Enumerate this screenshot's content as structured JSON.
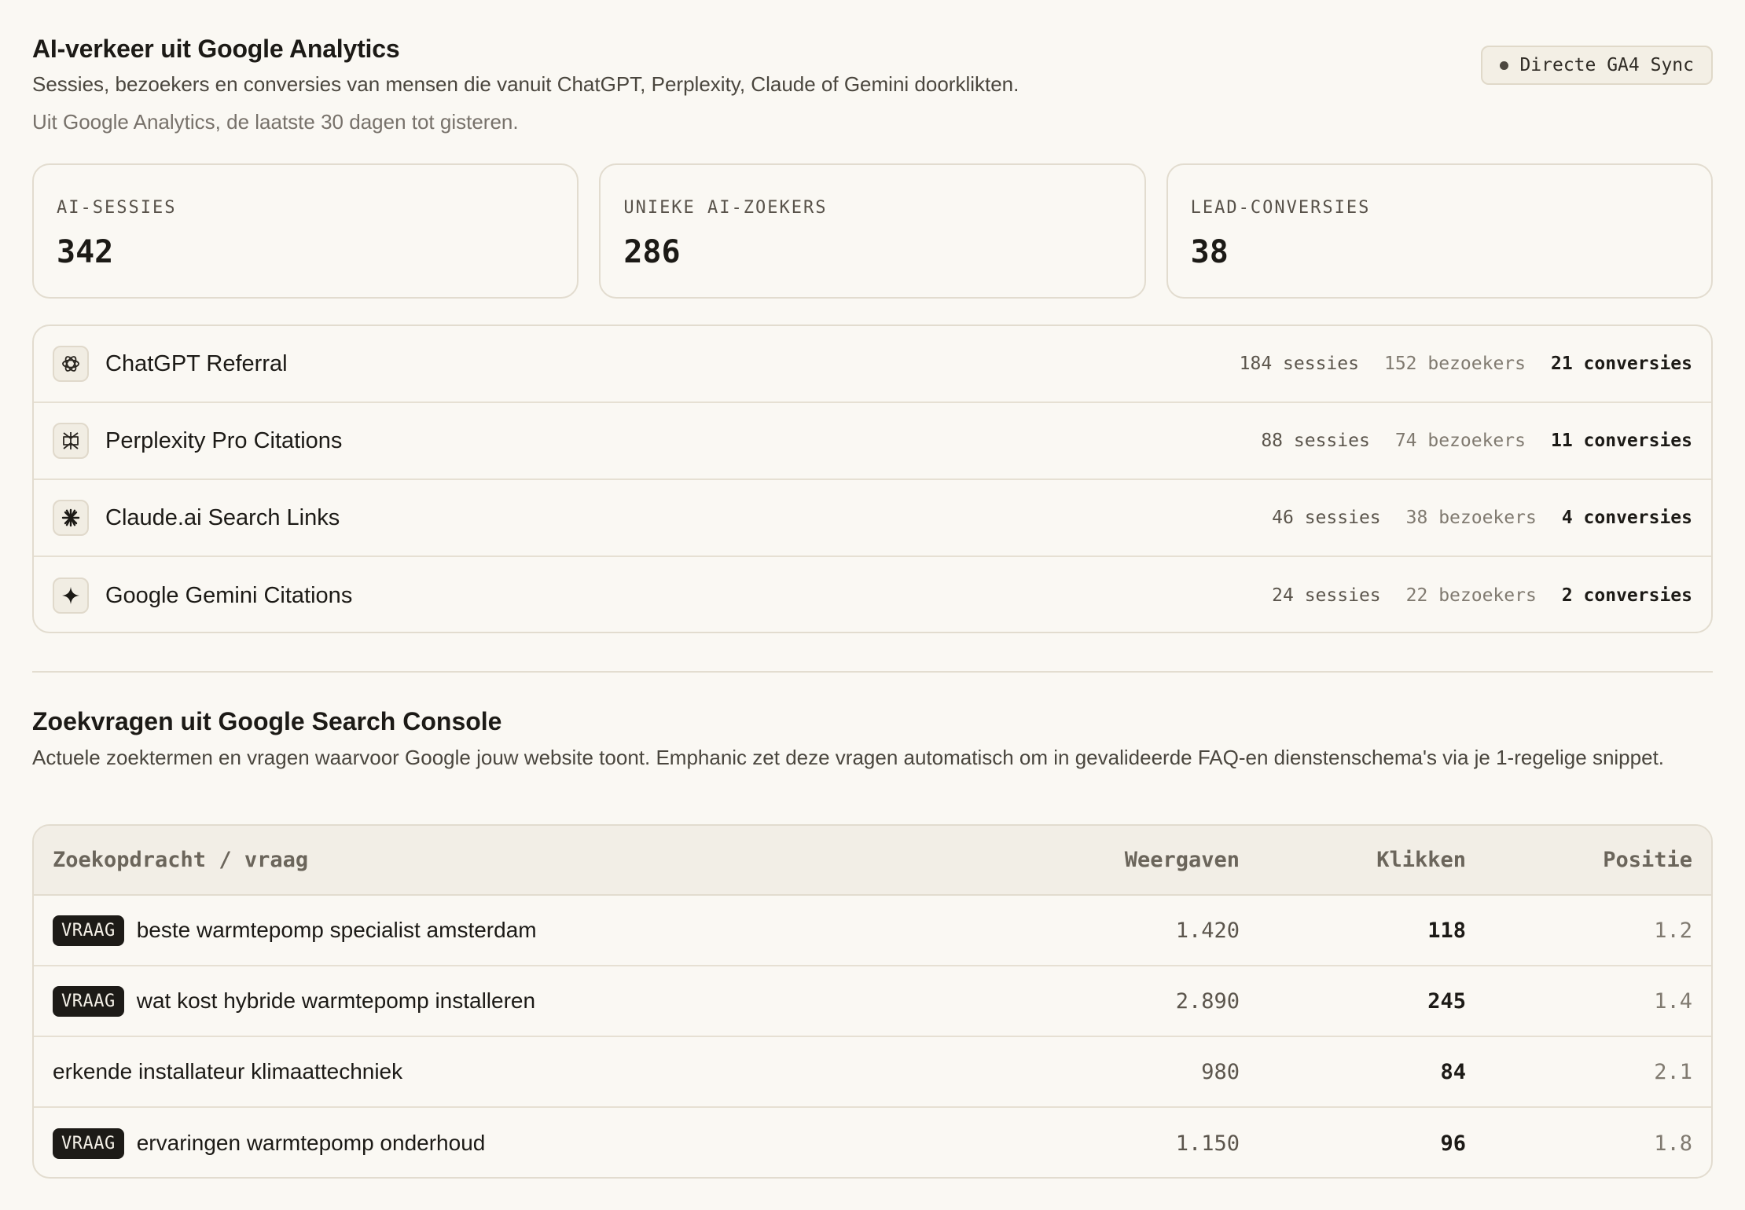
{
  "ga": {
    "title": "AI-verkeer uit Google Analytics",
    "subtitle": "Sessies, bezoekers en conversies van mensen die vanuit ChatGPT, Perplexity, Claude of Gemini doorklikten.",
    "note": "Uit Google Analytics, de laatste 30 dagen tot gisteren.",
    "sync_label": "Directe GA4 Sync",
    "metrics": [
      {
        "label": "AI-SESSIES",
        "value": "342"
      },
      {
        "label": "UNIEKE AI-ZOEKERS",
        "value": "286"
      },
      {
        "label": "LEAD-CONVERSIES",
        "value": "38"
      }
    ],
    "sources": [
      {
        "name": "ChatGPT Referral",
        "icon": "chatgpt-icon",
        "sessions": "184 sessies",
        "visitors": "152 bezoekers",
        "conversions": "21 conversies"
      },
      {
        "name": "Perplexity Pro Citations",
        "icon": "perplexity-icon",
        "sessions": "88 sessies",
        "visitors": "74 bezoekers",
        "conversions": "11 conversies"
      },
      {
        "name": "Claude.ai Search Links",
        "icon": "claude-icon",
        "sessions": "46 sessies",
        "visitors": "38 bezoekers",
        "conversions": "4 conversies"
      },
      {
        "name": "Google Gemini Citations",
        "icon": "gemini-icon",
        "sessions": "24 sessies",
        "visitors": "22 bezoekers",
        "conversions": "2 conversies"
      }
    ]
  },
  "gsc": {
    "title": "Zoekvragen uit Google Search Console",
    "subtitle": "Actuele zoektermen en vragen waarvoor Google jouw website toont. Emphanic zet deze vragen automatisch om in gevalideerde FAQ-en dienstenschema's via je 1-regelige snippet.",
    "columns": {
      "query": "Zoekopdracht / vraag",
      "impressions": "Weergaven",
      "clicks": "Klikken",
      "position": "Positie"
    },
    "badge_label": "VRAAG",
    "rows": [
      {
        "is_question": true,
        "query": "beste warmtepomp specialist amsterdam",
        "impressions": "1.420",
        "clicks": "118",
        "position": "1.2"
      },
      {
        "is_question": true,
        "query": "wat kost hybride warmtepomp installeren",
        "impressions": "2.890",
        "clicks": "245",
        "position": "1.4"
      },
      {
        "is_question": false,
        "query": "erkende installateur klimaattechniek",
        "impressions": "980",
        "clicks": "84",
        "position": "2.1"
      },
      {
        "is_question": true,
        "query": "ervaringen warmtepomp onderhoud",
        "impressions": "1.150",
        "clicks": "96",
        "position": "1.8"
      }
    ]
  }
}
